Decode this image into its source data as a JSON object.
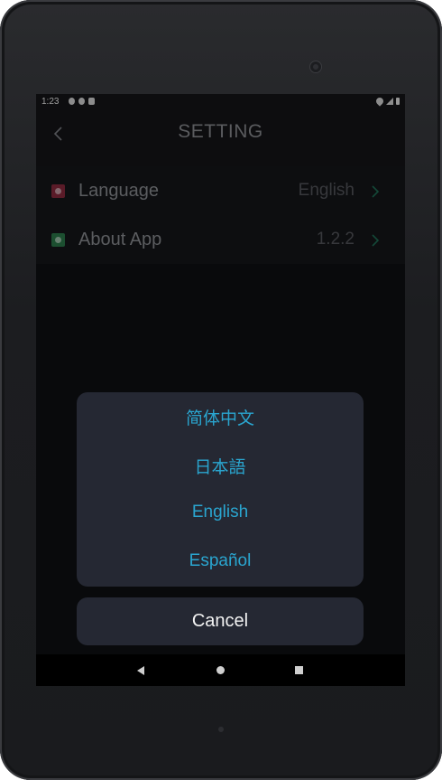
{
  "status_bar": {
    "time": "1:23"
  },
  "header": {
    "title": "SETTING"
  },
  "settings": {
    "items": [
      {
        "label": "Language",
        "value": "English",
        "icon": "language-icon",
        "icon_color": "#8b2a3e"
      },
      {
        "label": "About App",
        "value": "1.2.2",
        "icon": "info-icon",
        "icon_color": "#2b7a4b"
      }
    ]
  },
  "language_sheet": {
    "options": [
      "简体中文",
      "日本語",
      "English",
      "Español"
    ],
    "cancel_label": "Cancel",
    "option_color": "#2aa5cf"
  },
  "nav_bar": {
    "icons": [
      "back-icon",
      "home-icon",
      "recents-icon"
    ]
  }
}
